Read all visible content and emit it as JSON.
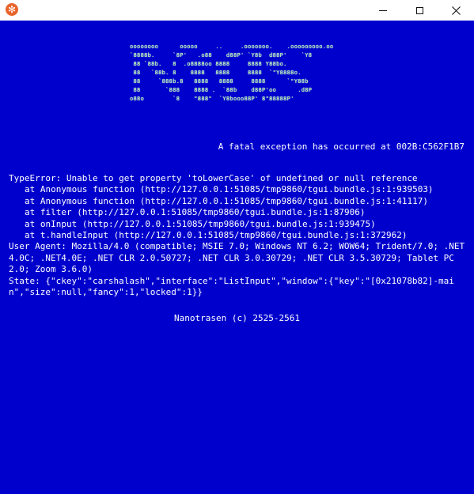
{
  "window": {
    "icon": "tgui-app-icon",
    "controls": [
      "minimize-icon",
      "maximize-icon",
      "close-icon"
    ]
  },
  "ascii_art": [
    "  oooooooo      ooooo     ..     .ooooooo.    .ooooooooo.oo",
    "  `8888b.     `8P'   .o88    d88P' `Y8b  d88P'    `Y8",
    "   88 `88b.   8  .o8888oo 8888     8888 Y88bo.",
    "   88   `88b. 8    8888   8888     8888  `\"Y8888o.",
    "   88     `888b.8   8888   8888     8888      `\"Y88b",
    "   88       `888    8888 .  `88b    d88P'oo      .d8P",
    "  o88o        `8    \"888\"  `Y8booo88P' 8\"88888P'"
  ],
  "fatal_message": "A fatal exception has occurred at 002B:C562F1B7",
  "error": {
    "message": "TypeError: Unable to get property 'toLowerCase' of undefined or null reference",
    "stack": [
      "at Anonymous function (http://127.0.0.1:51085/tmp9860/tgui.bundle.js:1:939503)",
      "at Anonymous function (http://127.0.0.1:51085/tmp9860/tgui.bundle.js:1:41117)",
      "at filter (http://127.0.0.1:51085/tmp9860/tgui.bundle.js:1:87906)",
      "at onInput (http://127.0.0.1:51085/tmp9860/tgui.bundle.js:1:939475)",
      "at t.handleInput (http://127.0.0.1:51085/tmp9860/tgui.bundle.js:1:372962)"
    ],
    "user_agent": "User Agent: Mozilla/4.0 (compatible; MSIE 7.0; Windows NT 6.2; WOW64; Trident/7.0; .NET 4.0C; .NET4.0E; .NET CLR 2.0.50727; .NET CLR 3.0.30729; .NET CLR 3.5.30729; Tablet PC 2.0; Zoom 3.6.0)",
    "state": "State: {\"ckey\":\"carshalash\",\"interface\":\"ListInput\",\"window\":{\"key\":\"[0x21078b82]-main\",\"size\":null,\"fancy\":1,\"locked\":1}}"
  },
  "footer": "Nanotrasen (c) 2525-2561",
  "colors": {
    "background": "#0000cc",
    "text": "#ffffff",
    "ascii": "#b9ffb0"
  }
}
